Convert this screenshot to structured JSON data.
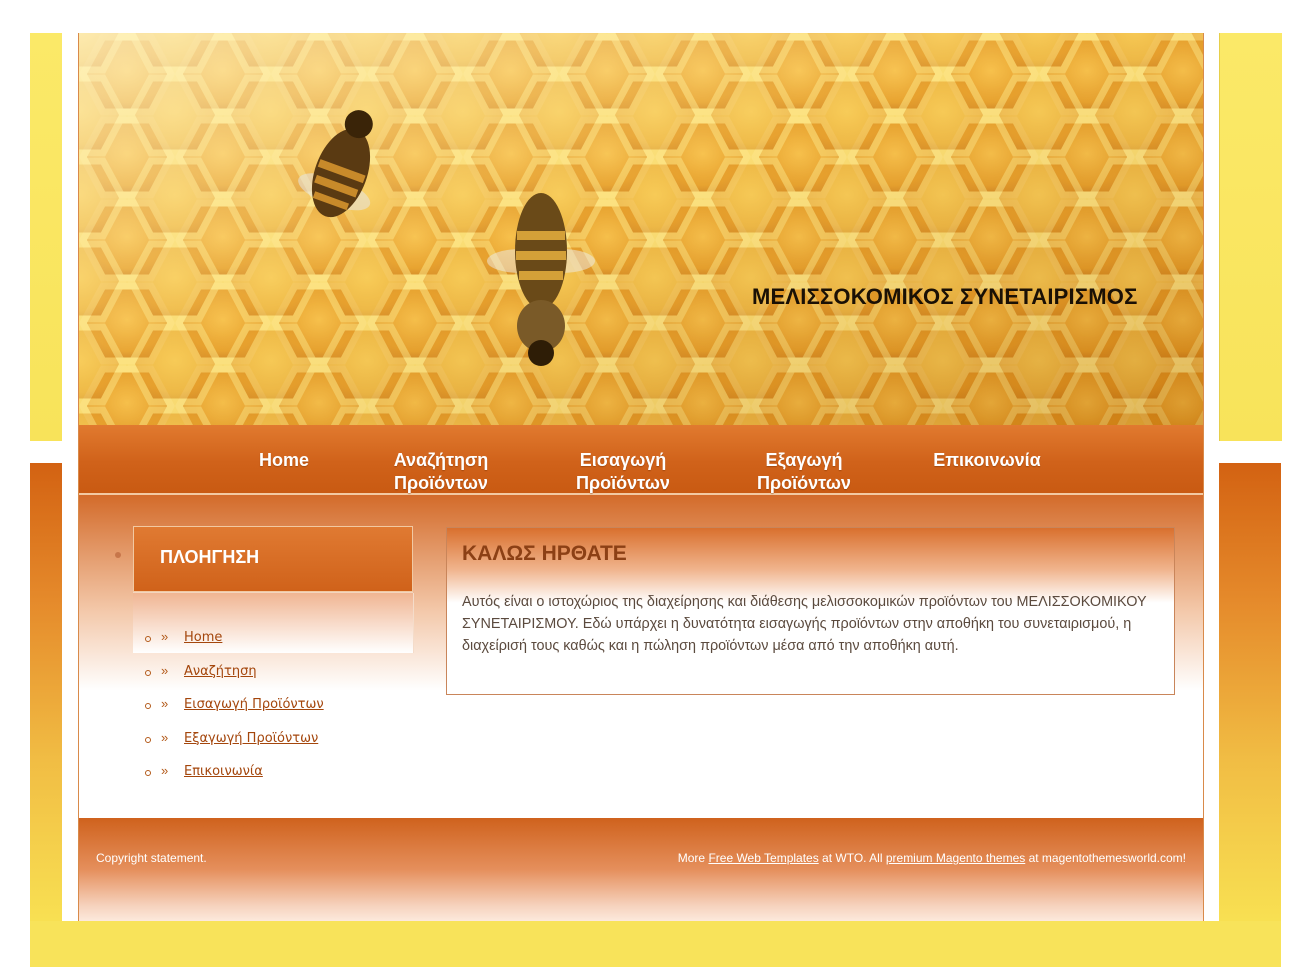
{
  "header": {
    "site_title": "ΜΕΛΙΣΣΟΚΟΜΙΚΟΣ ΣΥΝΕΤΑΙΡΙΣΜΟΣ"
  },
  "nav": {
    "items": [
      {
        "line1": "Home",
        "line2": ""
      },
      {
        "line1": "Αναζήτηση",
        "line2": "Προϊόντων"
      },
      {
        "line1": "Εισαγωγή",
        "line2": "Προϊόντων"
      },
      {
        "line1": "Εξαγωγή",
        "line2": "Προϊόντων"
      },
      {
        "line1": "Επικοινωνία",
        "line2": ""
      }
    ]
  },
  "sidebar": {
    "title": "ΠΛΟΗΓΗΣΗ",
    "bullet_glyph": "»",
    "links": [
      "Home",
      "Αναζήτηση",
      "Εισαγωγή Προϊόντων",
      "Εξαγωγή Προϊόντων",
      "Επικοινωνία"
    ]
  },
  "welcome": {
    "title": "ΚΑΛΩΣ ΗΡΘΑΤΕ",
    "text": "Αυτός είναι ο ιστοχώριος της διαχείρησης και διάθεσης μελισσοκομικών προϊόντων του ΜΕΛΙΣΣΟΚΟΜΙΚΟΥ ΣΥΝΕΤΑΙΡΙΣΜΟΥ. Εδώ υπάρχει η δυνατότητα εισαγωγής προϊόντων στην αποθήκη του συνεταιρισμού, η διαχείρισή τους καθώς και η πώληση προϊόντων μέσα από την αποθήκη αυτή."
  },
  "footer": {
    "copyright": "Copyright statement.",
    "more_prefix": "More ",
    "link1": "Free Web Templates",
    "mid_text": " at WTO. All ",
    "link2": "premium Magento themes",
    "suffix": " at magentothemesworld.com!"
  },
  "colors": {
    "accent_orange": "#d0621a",
    "frame_yellow": "#f8e35a",
    "link_color": "#a4460c",
    "title_brown": "#8c4015"
  }
}
